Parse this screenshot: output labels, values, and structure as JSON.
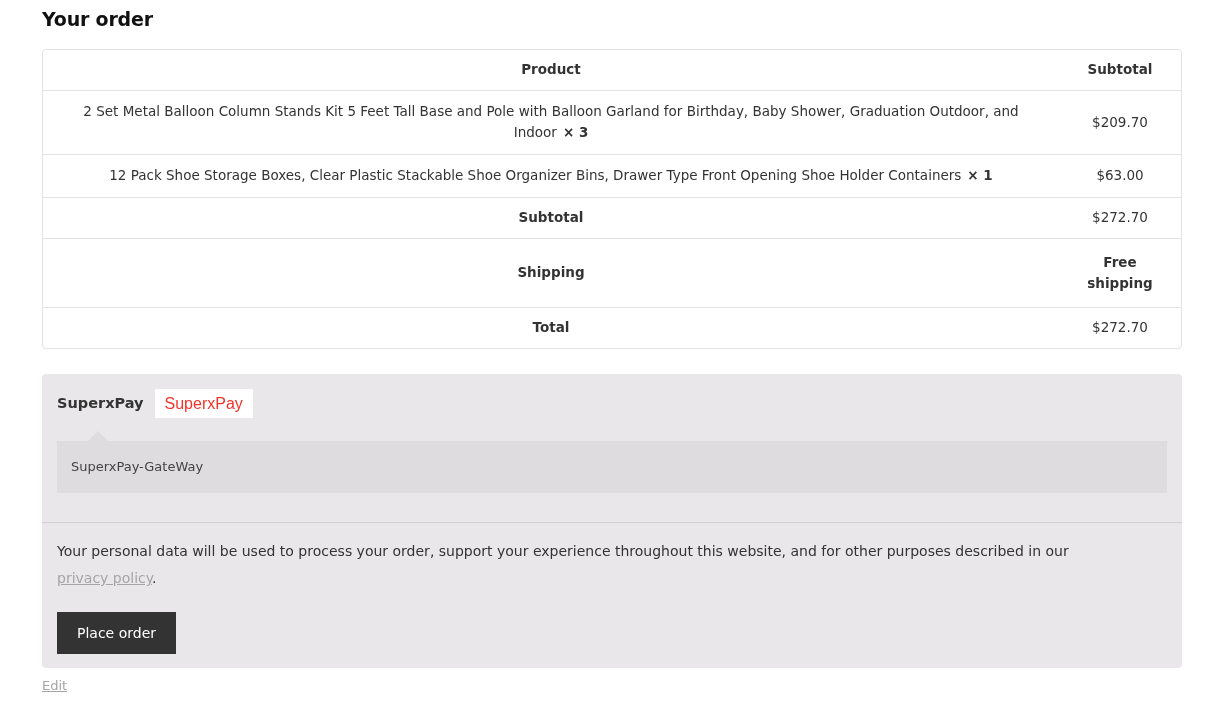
{
  "heading": "Your order",
  "order_table": {
    "columns": [
      "Product",
      "Subtotal"
    ],
    "items": [
      {
        "name": "2 Set Metal Balloon Column Stands Kit 5 Feet Tall Base and Pole with Balloon Garland for Birthday, Baby Shower, Graduation Outdoor, and Indoor",
        "quantity": "× 3",
        "subtotal": "$209.70"
      },
      {
        "name": "12 Pack Shoe Storage Boxes, Clear Plastic Stackable Shoe Organizer Bins, Drawer Type Front Opening Shoe Holder Containers",
        "quantity": "× 1",
        "subtotal": "$63.00"
      }
    ],
    "totals": [
      {
        "label": "Subtotal",
        "value": "$272.70",
        "kind": "amount"
      },
      {
        "label": "Shipping",
        "value": "Free shipping",
        "kind": "note"
      },
      {
        "label": "Total",
        "value": "$272.70",
        "kind": "amount"
      }
    ]
  },
  "payment": {
    "methods": [
      {
        "label": "SuperxPay",
        "logo_text": "SuperxPay",
        "description": "SuperxPay-GateWay"
      }
    ],
    "privacy_notice": {
      "text": "Your personal data will be used to process your order, support your experience throughout this website, and for other purposes described in our ",
      "link": "privacy policy",
      "after": "."
    },
    "button": "Place order"
  },
  "edit_link": "Edit"
}
